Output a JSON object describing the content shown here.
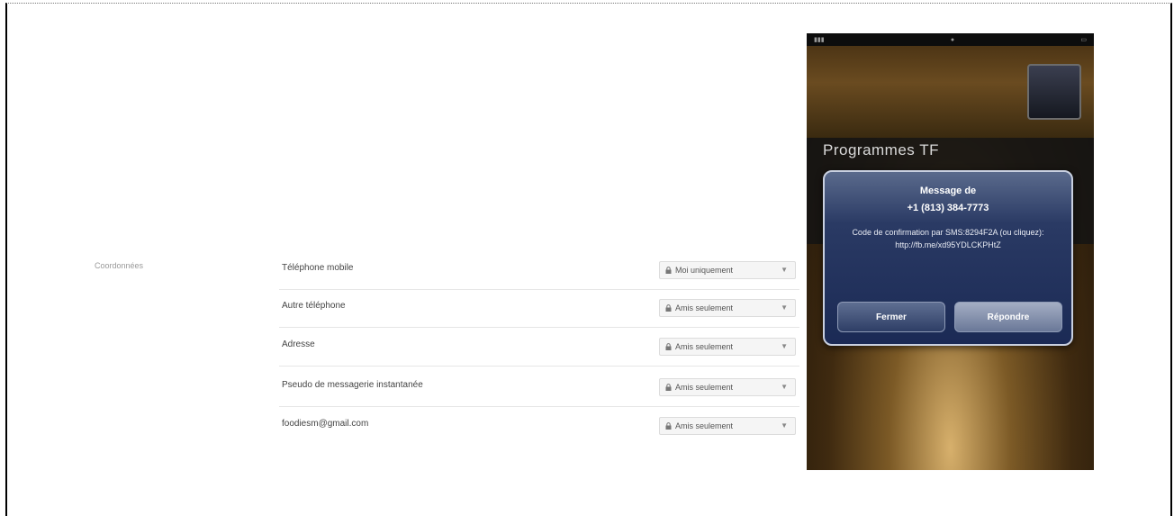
{
  "section": {
    "label": "Coordonnées"
  },
  "rows": [
    {
      "label": "Téléphone mobile",
      "privacy": "Moi uniquement"
    },
    {
      "label": "Autre téléphone",
      "privacy": "Amis seulement"
    },
    {
      "label": "Adresse",
      "privacy": "Amis seulement"
    },
    {
      "label": "Pseudo de messagerie instantanée",
      "privacy": "Amis seulement"
    },
    {
      "label": "foodiesm@gmail.com",
      "privacy": "Amis seulement"
    }
  ],
  "phone": {
    "background_title": "Programmes TF",
    "alert": {
      "title": "Message de",
      "number": "+1 (813) 384-7773",
      "body": "Code de confirmation par SMS:8294F2A (ou cliquez): http://fb.me/xd95YDLCKPHtZ",
      "close_label": "Fermer",
      "reply_label": "Répondre"
    }
  }
}
